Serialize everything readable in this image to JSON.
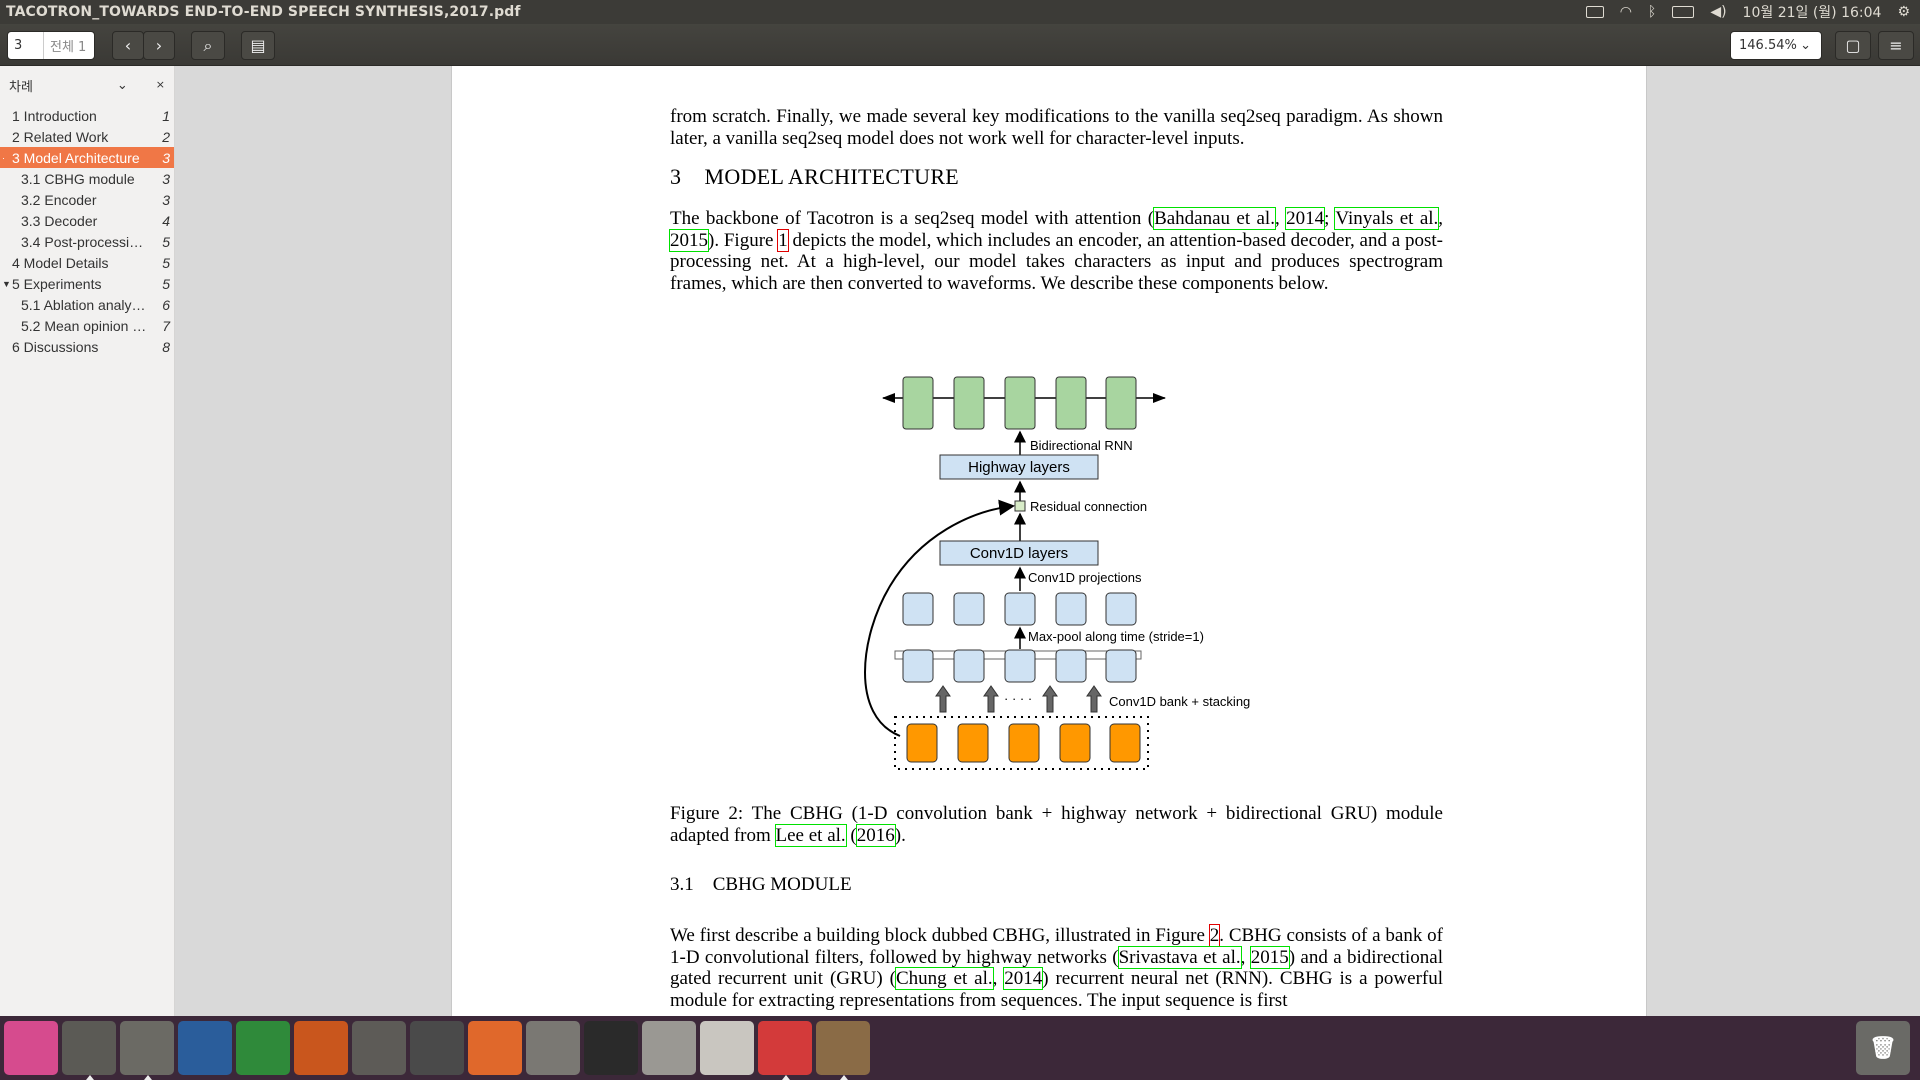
{
  "window": {
    "title": "TACOTRON_TOWARDS END-TO-END SPEECH SYNTHESIS,2017.pdf"
  },
  "indicators": {
    "datetime": "10월 21일 (월) 16:04"
  },
  "toolbar": {
    "page_value": "3",
    "page_total": "전체 1",
    "zoom": "146.54%"
  },
  "sidebar": {
    "header": "차례",
    "items": [
      {
        "label": "1 Introduction",
        "page": "1"
      },
      {
        "label": "2 Related Work",
        "page": "2"
      },
      {
        "label": "3 Model Architecture",
        "page": "3"
      },
      {
        "label": "3.1 CBHG module",
        "page": "3"
      },
      {
        "label": "3.2 Encoder",
        "page": "3"
      },
      {
        "label": "3.3 Decoder",
        "page": "4"
      },
      {
        "label": "3.4 Post-processi…",
        "page": "5"
      },
      {
        "label": "4 Model Details",
        "page": "5"
      },
      {
        "label": "5 Experiments",
        "page": "5"
      },
      {
        "label": "5.1 Ablation analy…",
        "page": "6"
      },
      {
        "label": "5.2 Mean opinion …",
        "page": "7"
      },
      {
        "label": "6 Discussions",
        "page": "8"
      }
    ]
  },
  "doc": {
    "p1": "from scratch. Finally, we made several key modifications to the vanilla seq2seq paradigm. As shown later, a vanilla seq2seq model does not work well for character-level inputs.",
    "sec_num": "3",
    "sec_title": "MODEL ARCHITECTURE",
    "p2_a": "The backbone of Tacotron is a seq2seq model with attention (",
    "p2_l1": "Bahdanau et al.",
    "p2_b": ", ",
    "p2_l2": "2014",
    "p2_c": "; ",
    "p2_l3": "Vinyals et al.",
    "p2_d": ", ",
    "p2_l4": "2015",
    "p2_e": "). Figure ",
    "p2_l5": "1",
    "p2_f": " depicts the model, which includes an encoder, an attention-based decoder, and a post-processing net. At a high-level, our model takes characters as input and produces spectrogram frames, which are then converted to waveforms. We describe these components below.",
    "fig_labels": {
      "birnn": "Bidirectional RNN",
      "highway": "Highway layers",
      "residual": "Residual connection",
      "conv1d": "Conv1D layers",
      "proj": "Conv1D projections",
      "maxpool": "Max-pool along time (stride=1)",
      "bank": "Conv1D bank + stacking",
      "dots": "· · · ·"
    },
    "cap_a": "Figure 2: The CBHG (1-D convolution bank + highway network + bidirectional GRU) module adapted from ",
    "cap_l1": "Lee et al.",
    "cap_b": " (",
    "cap_l2": "2016",
    "cap_c": ").",
    "sub_num": "3.1",
    "sub_title": "CBHG MODULE",
    "p3_a": "We first describe a building block dubbed CBHG, illustrated in Figure ",
    "p3_l1": "2",
    "p3_b": ". CBHG consists of a bank of 1-D convolutional filters, followed by highway networks (",
    "p3_l2": "Srivastava et al.",
    "p3_c": ", ",
    "p3_l3": "2015",
    "p3_d": ") and a bidirectional gated recurrent unit (GRU) (",
    "p3_l4": "Chung et al.",
    "p3_e": ", ",
    "p3_l5": "2014",
    "p3_f": ") recurrent neural net (RNN). CBHG is a powerful module for extracting representations from sequences. The input sequence is first"
  },
  "dock": [
    {
      "name": "ubuntu-launcher",
      "color": "#d64b8e"
    },
    {
      "name": "chrome",
      "color": "#5b5a55"
    },
    {
      "name": "files",
      "color": "#6b6a64"
    },
    {
      "name": "writer",
      "color": "#2a5d9b"
    },
    {
      "name": "calc",
      "color": "#2f8a3a"
    },
    {
      "name": "impress",
      "color": "#c9561d"
    },
    {
      "name": "calculator",
      "color": "#5d5b57"
    },
    {
      "name": "video",
      "color": "#4a4a4a"
    },
    {
      "name": "software",
      "color": "#e0682b"
    },
    {
      "name": "settings",
      "color": "#7a7873"
    },
    {
      "name": "monitor",
      "color": "#2a2a2a"
    },
    {
      "name": "scanner",
      "color": "#9a9893"
    },
    {
      "name": "editor",
      "color": "#c9c6c0"
    },
    {
      "name": "pdf-viewer",
      "color": "#d33a3a"
    },
    {
      "name": "gimp",
      "color": "#8a6b46"
    }
  ],
  "colors": {
    "accent": "#f07746",
    "link_green": "#00e000",
    "link_red": "#e00000",
    "bar": "#3c3b37",
    "dock": "#3c2839"
  }
}
